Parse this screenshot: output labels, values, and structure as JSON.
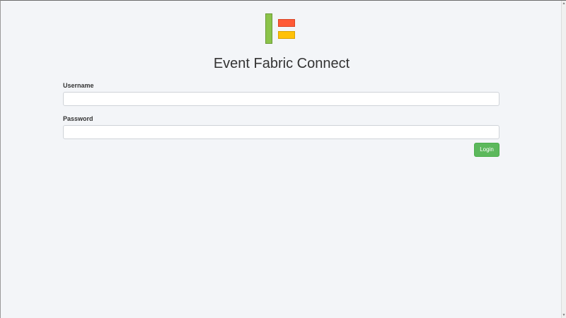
{
  "app": {
    "title": "Event Fabric Connect",
    "logo_icon": "event-fabric-logo-icon",
    "logo_colors": {
      "green": "#8bc34a",
      "red": "#ff5a36",
      "yellow": "#ffc107"
    }
  },
  "form": {
    "username_label": "Username",
    "username_value": "",
    "password_label": "Password",
    "password_value": "",
    "login_label": "Login",
    "login_color": "#5cb85c"
  },
  "scrollbar": {
    "up_icon": "scroll-up-arrow-icon",
    "down_icon": "scroll-down-arrow-icon"
  }
}
